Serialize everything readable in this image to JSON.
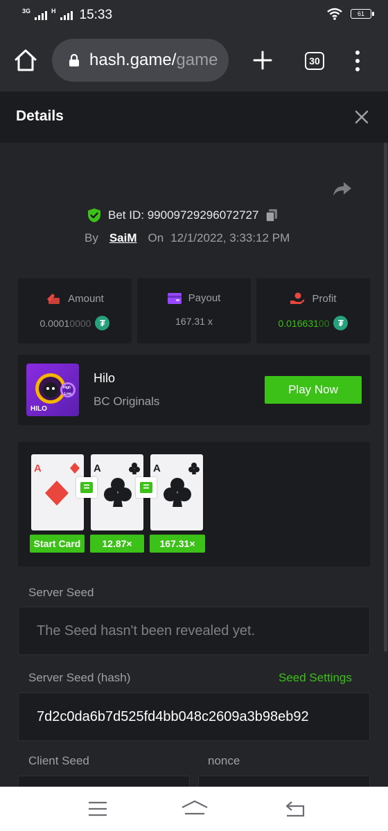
{
  "status": {
    "network_1": "3G",
    "network_2": "H",
    "time": "15:33",
    "battery": "61"
  },
  "browser": {
    "url_main": "hash.game/",
    "url_dim": "game",
    "tab_count": "30"
  },
  "header": {
    "title": "Details"
  },
  "bet": {
    "id_label": "Bet ID:",
    "id_value": "99009729296072727",
    "by_label": "By",
    "user": "SaiM",
    "on_label": "On",
    "date": "12/1/2022, 3:33:12 PM"
  },
  "stats": {
    "amount_label": "Amount",
    "amount_main": "0.0001",
    "amount_faded": "0000",
    "payout_label": "Payout",
    "payout_value": "167.31 x",
    "profit_label": "Profit",
    "profit_main": "0.016631",
    "profit_faded": "00",
    "token_symbol": "₮"
  },
  "game": {
    "name": "Hilo",
    "provider": "BC Originals",
    "thumb_label": "HILO",
    "thumb_badge_top": "High",
    "thumb_badge_bottom": "Low",
    "play_label": "Play Now"
  },
  "cards": [
    {
      "rank": "A",
      "suit": "diamond",
      "color": "#e9473d",
      "badge": "Start Card"
    },
    {
      "rank": "A",
      "suit": "club",
      "color": "#1b1c1f",
      "badge": "12.87×"
    },
    {
      "rank": "A",
      "suit": "club",
      "color": "#1b1c1f",
      "badge": "167.31×"
    }
  ],
  "equals_symbol": "=",
  "seeds": {
    "server_label": "Server Seed",
    "server_placeholder": "The Seed hasn't been revealed yet.",
    "server_hash_label": "Server Seed (hash)",
    "settings_link": "Seed Settings",
    "server_hash": "7d2c0da6b7d525fd4bb048c2609a3b98eb92",
    "client_label": "Client Seed",
    "nonce_label": "nonce"
  },
  "colors": {
    "accent_green": "#3bc117",
    "background": "#232528",
    "panel": "#1b1c1f",
    "tether": "#26a17b"
  }
}
